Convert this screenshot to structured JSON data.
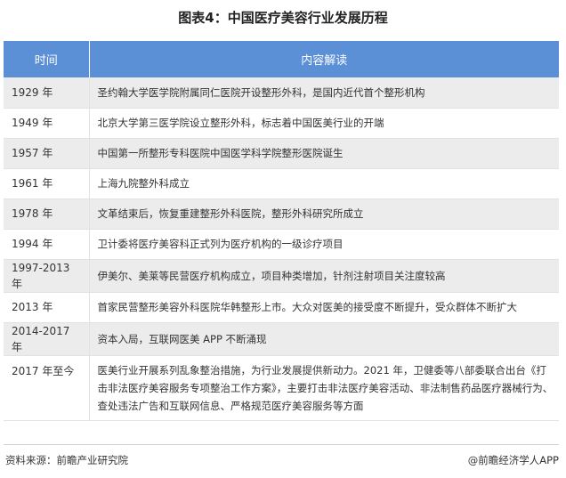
{
  "title": "图表4：中国医疗美容行业发展历程",
  "table": {
    "headers": [
      "时间",
      "内容解读"
    ],
    "rows": [
      {
        "year": "1929 年",
        "content": "圣约翰大学医学院附属同仁医院开设整形外科，是国内近代首个整形机构"
      },
      {
        "year": "1949 年",
        "content": "北京大学第三医学院设立整形外科，标志着中国医美行业的开端"
      },
      {
        "year": "1957 年",
        "content": "中国第一所整形专科医院中国医学科学院整形医院诞生"
      },
      {
        "year": "1961 年",
        "content": "上海九院整外科成立"
      },
      {
        "year": "1978 年",
        "content": "文革结束后，恢复重建整形外科医院，整形外科研究所成立"
      },
      {
        "year": "1994 年",
        "content": "卫计委将医疗美容科正式列为医疗机构的一级诊疗项目"
      },
      {
        "year": "1997-2013 年",
        "content": "伊美尔、美莱等民营医疗机构成立，项目种类增加，针剂注射项目关注度较高"
      },
      {
        "year": "2013 年",
        "content": "首家民营整形美容外科医院华韩整形上市。大众对医美的接受度不断提升，受众群体不断扩大"
      },
      {
        "year": "2014-2017 年",
        "content": "资本入局，互联网医美 APP 不断涌现"
      },
      {
        "year": "2017 年至今",
        "content": "医美行业开展系列乱象整治措施，为行业发展提供新动力。2021 年，卫健委等八部委联合出台《打击非法医疗美容服务专项整治工作方案》，主要打击非法医疗美容活动、非法制售药品医疗器械行为、查处违法广告和互联网信息、严格规范医疗美容服务等方面"
      }
    ]
  },
  "footer": {
    "source": "资料来源：前瞻产业研究院",
    "brand": "@前瞻经济学人APP"
  }
}
